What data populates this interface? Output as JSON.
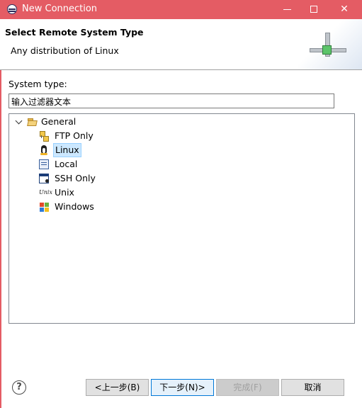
{
  "window": {
    "title": "New Connection",
    "min_label": "",
    "max_label": "",
    "close_label": "✕"
  },
  "banner": {
    "title": "Select Remote System Type",
    "description": "Any distribution of Linux"
  },
  "filter": {
    "label": "System type:",
    "value": "输入过滤器文本"
  },
  "tree": {
    "root": {
      "label": "General",
      "expanded": true,
      "icon": "folder-open-icon"
    },
    "items": [
      {
        "label": "FTP Only",
        "icon": "ftp-icon",
        "selected": false
      },
      {
        "label": "Linux",
        "icon": "tux-icon",
        "selected": true
      },
      {
        "label": "Local",
        "icon": "local-computer-icon",
        "selected": false
      },
      {
        "label": "SSH Only",
        "icon": "ssh-terminal-icon",
        "selected": false
      },
      {
        "label": "Unix",
        "icon": "unix-icon",
        "selected": false,
        "icon_text": "Unix"
      },
      {
        "label": "Windows",
        "icon": "windows-icon",
        "selected": false
      }
    ]
  },
  "footer": {
    "help_label": "?",
    "back_label": "<上一步(B)",
    "next_label": "下一步(N)>",
    "finish_label": "完成(F)",
    "cancel_label": "取消"
  },
  "colors": {
    "titlebar": "#e45c64",
    "selection": "#cce8ff",
    "default_button_border": "#0078d7"
  }
}
